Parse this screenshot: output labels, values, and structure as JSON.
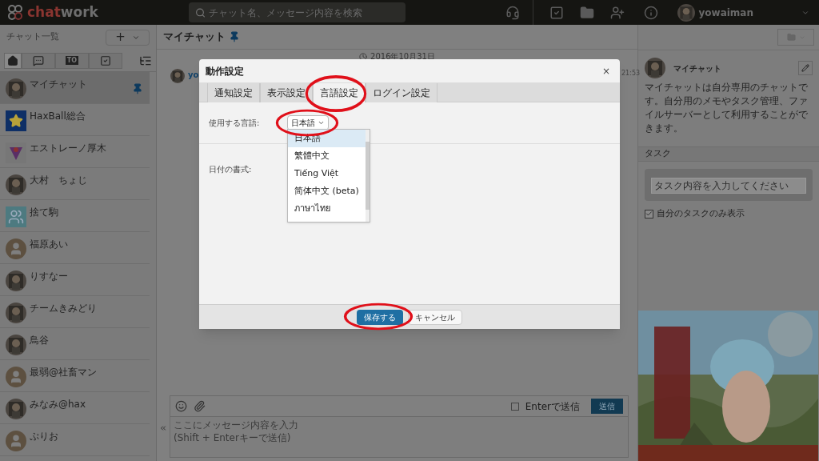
{
  "header": {
    "logo_part1": "chat",
    "logo_part2": "work",
    "search": {
      "placeholder": "チャット名、メッセージ内容を検索"
    },
    "username": "yowaiman"
  },
  "sidebar": {
    "title": "チャット一覧",
    "add_button": "+",
    "filter_tabs": [
      {
        "kind": "home",
        "selected": true
      },
      {
        "kind": "mention",
        "selected": false
      },
      {
        "kind": "to",
        "label": "TO",
        "selected": false
      },
      {
        "kind": "task",
        "selected": false
      }
    ],
    "chats": [
      {
        "name": "マイチャット",
        "selected": true,
        "pinned": true
      },
      {
        "name": "HaxBall総合",
        "selected": false,
        "pinned": false,
        "kind": "star"
      },
      {
        "name": "エストレーノ厚木",
        "selected": false,
        "pinned": false,
        "kind": "emblem"
      },
      {
        "name": "大村　ちょじ",
        "selected": false,
        "pinned": false
      },
      {
        "name": "捨て駒",
        "selected": false,
        "pinned": false,
        "kind": "group"
      },
      {
        "name": "福原あい",
        "selected": false,
        "pinned": false,
        "kind": "default"
      },
      {
        "name": "りすなー",
        "selected": false,
        "pinned": false
      },
      {
        "name": "チームきみどり",
        "selected": false,
        "pinned": false
      },
      {
        "name": "鳥谷",
        "selected": false,
        "pinned": false
      },
      {
        "name": "最弱@社畜マン",
        "selected": false,
        "pinned": false,
        "kind": "default"
      },
      {
        "name": "みなみ@hax",
        "selected": false,
        "pinned": false
      },
      {
        "name": "ぷりお",
        "selected": false,
        "pinned": false,
        "kind": "default"
      }
    ]
  },
  "chat": {
    "title": "マイチャット",
    "pinned": true,
    "date": "2016年10月31日",
    "sender_fragment": "yo",
    "time": "21:53",
    "composer": {
      "placeholder": "ここにメッセージ内容を入力\n(Shift + Enterキーで送信)",
      "enter_to_send": {
        "label": "Enterで送信",
        "checked": false
      },
      "send_button": "送信"
    }
  },
  "dialog": {
    "title": "動作設定",
    "close": "×",
    "tabs": [
      {
        "label": "通知設定",
        "selected": false
      },
      {
        "label": "表示設定",
        "selected": false
      },
      {
        "label": "言語設定",
        "selected": true
      },
      {
        "label": "ログイン設定",
        "selected": false
      }
    ],
    "language_label": "使用する言語:",
    "language_value": "日本語",
    "date_format_label": "日付の書式:",
    "language_options": [
      {
        "label": "日本語",
        "selected": true
      },
      {
        "label": "繁體中文",
        "selected": false
      },
      {
        "label": "Tiếng Việt",
        "selected": false
      },
      {
        "label": "简体中文 (beta)",
        "selected": false
      },
      {
        "label": "ภาษาไทย",
        "selected": false
      }
    ],
    "save_button": "保存する",
    "cancel_button": "キャンセル"
  },
  "info_panel": {
    "title": "マイチャット",
    "description": "マイチャットは自分専用のチャットです。自分用のメモやタスク管理、ファイルサーバーとして利用することができます。",
    "tasks_heading": "タスク",
    "task_input": {
      "placeholder": "タスク内容を入力してください"
    },
    "my_tasks_only": {
      "label": "自分のタスクのみ表示",
      "checked": true
    }
  }
}
